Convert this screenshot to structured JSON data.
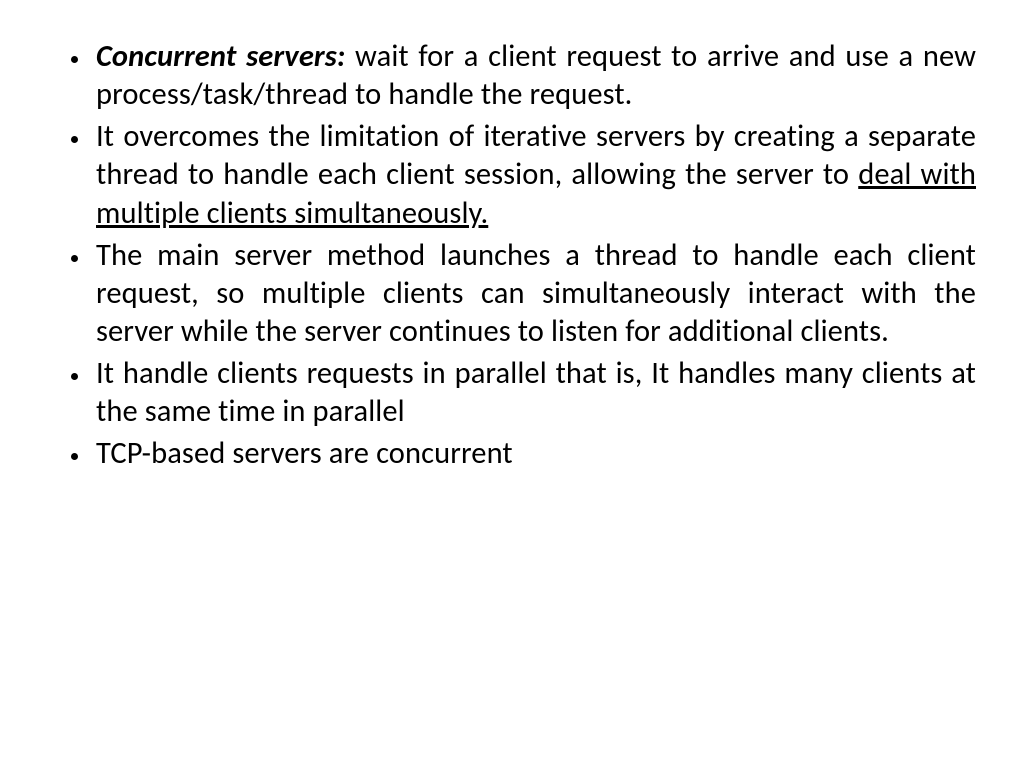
{
  "bullets": [
    {
      "lead": "Concurrent servers:",
      "tail": " wait for a client request to arrive and use a new process/task/thread to handle the request."
    },
    {
      "pre": "It overcomes the limitation of iterative servers by creating a separate thread to handle each client session, allowing the server to ",
      "underlined": "deal with multiple clients simultaneously."
    },
    {
      "text": "The main server method launches a thread to handle each client request, so multiple clients can simultaneously interact with the server while the server continues to listen  for additional clients."
    },
    {
      "text": "It handle clients requests in parallel that is, It handles many clients at the same time in parallel"
    },
    {
      "text": "TCP-based servers are concurrent"
    }
  ]
}
